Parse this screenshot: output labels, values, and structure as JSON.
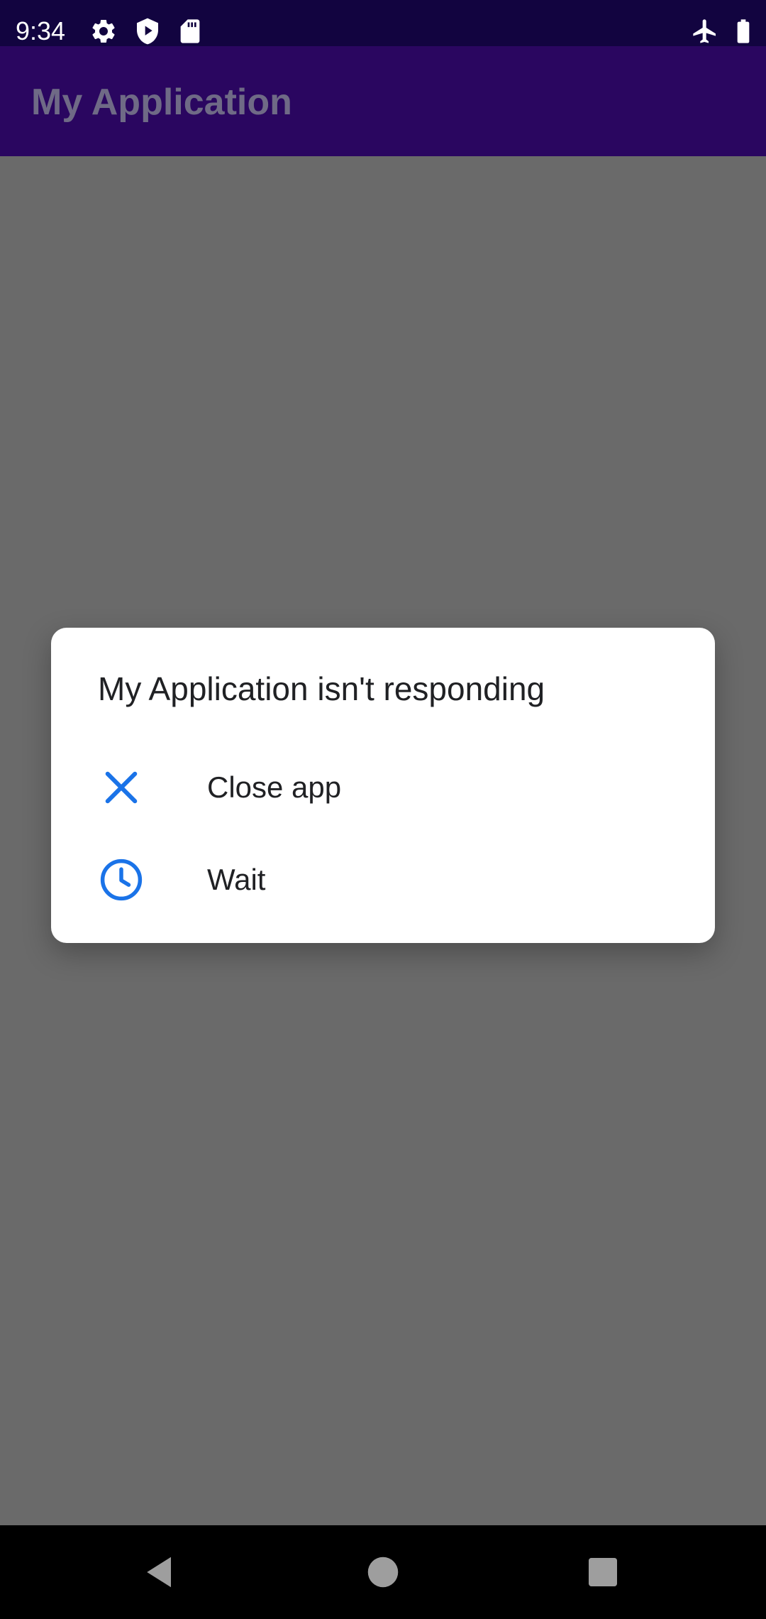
{
  "status_bar": {
    "time": "9:34",
    "icons_left": [
      "settings-gear-icon",
      "play-protect-shield-icon",
      "sd-card-icon"
    ],
    "icons_right": [
      "airplane-mode-icon",
      "battery-icon"
    ]
  },
  "app_bar": {
    "title": "My Application"
  },
  "dialog": {
    "title": "My Application isn't responding",
    "options": [
      {
        "label": "Close app",
        "icon": "close-icon"
      },
      {
        "label": "Wait",
        "icon": "clock-icon"
      }
    ]
  },
  "nav_bar": {
    "buttons": [
      "back-icon",
      "home-icon",
      "recents-icon"
    ]
  },
  "colors": {
    "status_bar": "#120440",
    "app_bar": "#2a0660",
    "scrim_background": "#6a6a6a",
    "dialog_background": "#ffffff",
    "accent_blue": "#1a73e8",
    "nav_bar": "#000000"
  }
}
